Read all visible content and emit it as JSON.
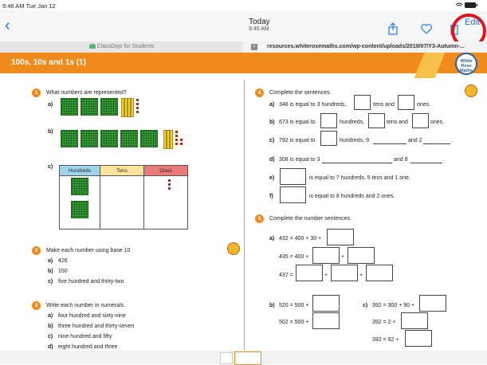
{
  "status": {
    "time_date": "9:46 AM  Tue Jan 12",
    "battery": "96%"
  },
  "nav": {
    "back": "‹",
    "title": "Today",
    "subtitle": "9:46 AM",
    "edit": "Edit"
  },
  "tabs": [
    {
      "label": "ClassDojo for Students"
    },
    {
      "close": "×",
      "label": "resources.whiterosemaths.com/wp-content/uploads/2019/07/Y3-Autumn-..."
    }
  ],
  "banner": {
    "title": "100s, 10s and 1s (1)",
    "logo": [
      "White",
      "Rose",
      "Maths"
    ]
  },
  "q1": {
    "num": "1",
    "text": "What numbers are represented?",
    "a": "a)",
    "b": "b)",
    "c": "c)",
    "table_headers": [
      "Hundreds",
      "Tens",
      "Ones"
    ]
  },
  "q2": {
    "num": "2",
    "text": "Make each number using base 10",
    "items": [
      {
        "label": "a)",
        "text": "426"
      },
      {
        "label": "b)",
        "text": "150"
      },
      {
        "label": "c)",
        "text": "five hundred and thirty-two"
      }
    ]
  },
  "q3": {
    "num": "3",
    "text": "Write each number in numerals.",
    "items": [
      {
        "label": "a)",
        "text": "four hundred and sixty-nine"
      },
      {
        "label": "b)",
        "text": "three hundred and thirty-seven"
      },
      {
        "label": "c)",
        "text": "nine hundred and fifty"
      },
      {
        "label": "d)",
        "text": "eight hundred and three"
      }
    ]
  },
  "q4": {
    "num": "4",
    "text": "Complete the sentences.",
    "a": {
      "label": "a)",
      "p1": "348 is equal to 3 hundreds,",
      "p2": "tens and",
      "p3": "ones."
    },
    "b": {
      "label": "b)",
      "p1": "673 is equal to",
      "p2": "hundreds,",
      "p3": "tens and",
      "p4": "ones."
    },
    "c": {
      "label": "c)",
      "p1": "792 is equal to",
      "p2": "hundreds, 9",
      "p3": "and 2",
      "p4": "."
    },
    "d": {
      "label": "d)",
      "p1": "308 is equal to 3",
      "p2": "and 8",
      "p3": "."
    },
    "e": {
      "label": "e)",
      "p1": "is equal to 7 hundreds, 5 tens and 1 one."
    },
    "f": {
      "label": "f)",
      "p1": "is equal to 8 hundreds and 2 ones."
    }
  },
  "q5": {
    "num": "5",
    "text": "Complete the number sentences.",
    "a_label": "a)",
    "a1": "432 = 400 + 30 +",
    "a2": "435 = 400 +",
    "a3": "437 =",
    "plus": "+",
    "b_label": "b)",
    "b1": "520 = 500 +",
    "b2": "502 = 500 +",
    "c_label": "c)",
    "c1": "392 = 300 + 90 +",
    "c2": "392 = 2 +",
    "c3": "392 = 92 +"
  }
}
